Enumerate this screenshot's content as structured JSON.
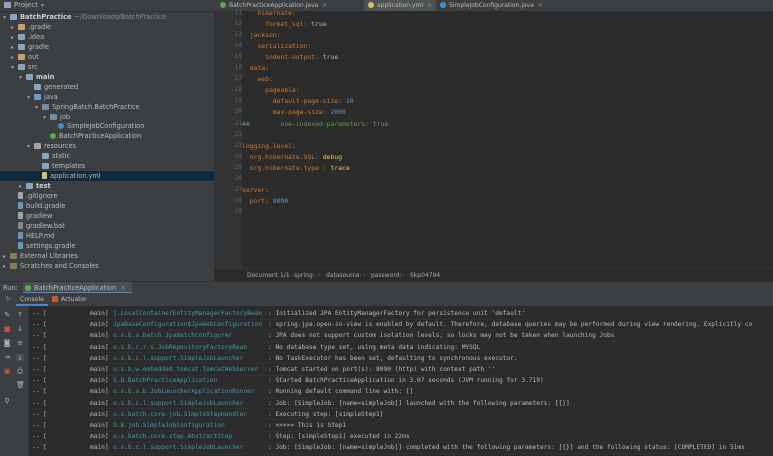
{
  "project": {
    "panel_title": "Project",
    "tree": [
      {
        "label": "BatchPractice",
        "suffix": "~/Downloads/BatchPractice",
        "indent": 0,
        "arrow": "▾",
        "icon": "folder",
        "bold": true
      },
      {
        "label": ".gradle",
        "indent": 1,
        "arrow": "▸",
        "icon": "folder orange"
      },
      {
        "label": ".idea",
        "indent": 1,
        "arrow": "▸",
        "icon": "folder"
      },
      {
        "label": "gradle",
        "indent": 1,
        "arrow": "▸",
        "icon": "folder"
      },
      {
        "label": "out",
        "indent": 1,
        "arrow": "▸",
        "icon": "folder orange"
      },
      {
        "label": "src",
        "indent": 1,
        "arrow": "▾",
        "icon": "folder"
      },
      {
        "label": "main",
        "indent": 2,
        "arrow": "▾",
        "icon": "folder",
        "bold": true
      },
      {
        "label": "generated",
        "indent": 3,
        "arrow": "",
        "icon": "folder"
      },
      {
        "label": "java",
        "indent": 3,
        "arrow": "▾",
        "icon": "folder src"
      },
      {
        "label": "SpringBatch.BatchPractice",
        "indent": 4,
        "arrow": "▾",
        "icon": "pkg"
      },
      {
        "label": "job",
        "indent": 5,
        "arrow": "▾",
        "icon": "pkg"
      },
      {
        "label": "SimpleJobConfiguration",
        "indent": 6,
        "arrow": "",
        "icon": "class-ico"
      },
      {
        "label": "BatchPracticeApplication",
        "indent": 5,
        "arrow": "",
        "icon": "class-ico boot"
      },
      {
        "label": "resources",
        "indent": 3,
        "arrow": "▾",
        "icon": "folder res"
      },
      {
        "label": "static",
        "indent": 4,
        "arrow": "",
        "icon": "folder"
      },
      {
        "label": "templates",
        "indent": 4,
        "arrow": "",
        "icon": "folder"
      },
      {
        "label": "application.yml",
        "indent": 4,
        "arrow": "",
        "icon": "file yml",
        "selected": true
      },
      {
        "label": "test",
        "indent": 2,
        "arrow": "▸",
        "icon": "folder",
        "bold": true
      },
      {
        "label": ".gitignore",
        "indent": 1,
        "arrow": "",
        "icon": "file"
      },
      {
        "label": "build.gradle",
        "indent": 1,
        "arrow": "",
        "icon": "file gradle"
      },
      {
        "label": "gradlew",
        "indent": 1,
        "arrow": "",
        "icon": "file"
      },
      {
        "label": "gradlew.bat",
        "indent": 1,
        "arrow": "",
        "icon": "file bat"
      },
      {
        "label": "HELP.md",
        "indent": 1,
        "arrow": "",
        "icon": "file md"
      },
      {
        "label": "settings.gradle",
        "indent": 1,
        "arrow": "",
        "icon": "file gradle"
      },
      {
        "label": "External Libraries",
        "indent": 0,
        "arrow": "▸",
        "icon": "lib"
      },
      {
        "label": "Scratches and Consoles",
        "indent": 0,
        "arrow": "▸",
        "icon": "lib"
      }
    ]
  },
  "tabs": [
    {
      "label": "BatchPracticeApplication.java",
      "icon_color": "#5ea84d",
      "active": false
    },
    {
      "label": "application.yml",
      "icon_color": "#d7c36c",
      "active": true
    },
    {
      "label": "SimpleJobConfiguration.java",
      "icon_color": "#3f8fcb",
      "active": false
    }
  ],
  "editor": {
    "lines": [
      {
        "n": "11",
        "html": "    <span class='k'>hibernate:</span>"
      },
      {
        "n": "12",
        "html": "      <span class='k'>format_sql:</span> <span class='plain'>true</span>"
      },
      {
        "n": "13",
        "html": "  <span class='k'>jackson:</span>"
      },
      {
        "n": "14",
        "html": "    <span class='k'>serialization:</span>"
      },
      {
        "n": "15",
        "html": "      <span class='k'>indent-output:</span> <span class='plain'>true</span>"
      },
      {
        "n": "16",
        "html": "  <span class='k'>data:</span>"
      },
      {
        "n": "17",
        "html": "    <span class='k'>web:</span>"
      },
      {
        "n": "18",
        "html": "      <span class='k'>pageable:</span>"
      },
      {
        "n": "19",
        "html": "        <span class='k'>default-page-size:</span> <span class='n'>10</span>"
      },
      {
        "n": "20",
        "html": "        <span class='k'>max-page-size:</span> <span class='n'>2000</span>"
      },
      {
        "n": "21",
        "html": "<span class='c'>##        one-indexed-parameters: true</span>"
      },
      {
        "n": "22",
        "html": ""
      },
      {
        "n": "23",
        "html": "<span class='k'>logging.level:</span>"
      },
      {
        "n": "24",
        "html": "  <span class='k'>org.hibernate.SQL:</span> <span class='ylw'>debug</span>"
      },
      {
        "n": "25",
        "html": "  <span class='k'>org.hibernate.type :</span> <span class='ylw'>trace</span>"
      },
      {
        "n": "26",
        "html": ""
      },
      {
        "n": "27",
        "html": "<span class='k'>server:</span>"
      },
      {
        "n": "28",
        "html": "  <span class='k'>port:</span> <span class='n'>8090</span>"
      },
      {
        "n": "29",
        "html": ""
      }
    ]
  },
  "breadcrumbs": [
    "Document 1/1",
    "spring:",
    "datasource:",
    "password:",
    "Skp04794"
  ],
  "run": {
    "label": "Run:",
    "config": "BatchPracticeApplication",
    "subtabs": [
      "Console",
      "Actuator"
    ],
    "log": [
      {
        "thread": "main]",
        "cls": "j.LocalContainerEntityManagerFactoryBean",
        "msg": ": Initialized JPA EntityManagerFactory for persistence unit 'default'"
      },
      {
        "thread": "main]",
        "cls": "JpaBaseConfiguration$JpaWebConfiguration",
        "msg": ": spring.jpa.open-in-view is enabled by default. Therefore, database queries may be performed during view rendering. Explicitly co"
      },
      {
        "thread": "main]",
        "cls": "o.s.b.a.batch.JpaBatchConfigurer",
        "msg": ": JPA does not support custom isolation levels, so locks may not be taken when launching Jobs"
      },
      {
        "thread": "main]",
        "cls": "o.s.b.c.r.s.JobRepositoryFactoryBean",
        "msg": ": No database type set, using meta data indicating: MYSQL"
      },
      {
        "thread": "main]",
        "cls": "o.s.b.c.l.support.SimpleJobLauncher",
        "msg": ": No TaskExecutor has been set, defaulting to synchronous executor."
      },
      {
        "thread": "main]",
        "cls": "o.s.b.w.embedded.tomcat.TomcatWebServer",
        "msg": ": Tomcat started on port(s): 8090 (http) with context path ''"
      },
      {
        "thread": "main]",
        "cls": "S.B.BatchPracticeApplication",
        "msg": ": Started BatchPracticeApplication in 3.07 seconds (JVM running for 3.719)"
      },
      {
        "thread": "main]",
        "cls": "o.s.b.a.b.JobLauncherApplicationRunner",
        "msg": ": Running default command line with: []"
      },
      {
        "thread": "main]",
        "cls": "o.s.b.c.l.support.SimpleJobLauncher",
        "msg": ": Job: [SimpleJob: [name=simpleJob]] launched with the following parameters: [{}]"
      },
      {
        "thread": "main]",
        "cls": "o.s.batch.core.job.SimpleStepHandler",
        "msg": ": Executing step: [simpleStep1]"
      },
      {
        "thread": "main]",
        "cls": "S.B.job.SimpleJobConfiguration",
        "msg": ": >>>>> This is Step1"
      },
      {
        "thread": "main]",
        "cls": "o.s.batch.core.step.AbstractStep",
        "msg": ": Step: [simpleStep1] executed in 22ms"
      },
      {
        "thread": "main]",
        "cls": "o.s.b.c.l.support.SimpleJobLauncher",
        "msg": ": Job: [SimpleJob: [name=simpleJob]] completed with the following parameters: [{}] and the following status: [COMPLETED] in 51ms"
      }
    ],
    "log_prefix": "-- ["
  }
}
